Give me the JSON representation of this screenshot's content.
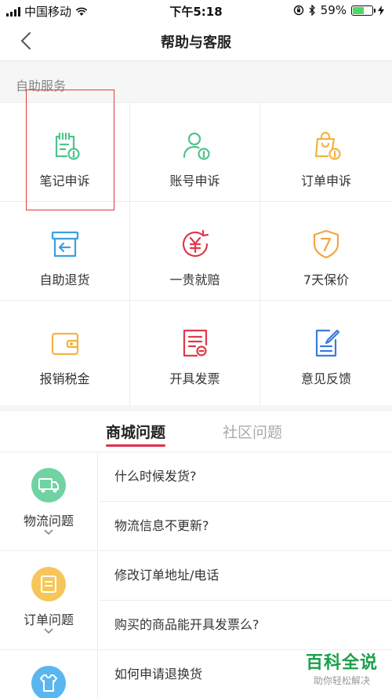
{
  "status_bar": {
    "carrier": "中国移动",
    "time": "下午5:18",
    "battery": "59%"
  },
  "nav": {
    "title": "帮助与客服"
  },
  "section": {
    "title": "自助服务"
  },
  "services": [
    {
      "label": "笔记申诉",
      "icon": "note-appeal-icon",
      "color": "#4fc38a"
    },
    {
      "label": "账号申诉",
      "icon": "account-appeal-icon",
      "color": "#4fc38a"
    },
    {
      "label": "订单申诉",
      "icon": "order-appeal-icon",
      "color": "#f2b43e"
    },
    {
      "label": "自助退货",
      "icon": "return-box-icon",
      "color": "#3a9fe0"
    },
    {
      "label": "一贵就赔",
      "icon": "compensation-icon",
      "color": "#e0394b"
    },
    {
      "label": "7天保价",
      "icon": "price-protect-icon",
      "color": "#f2a53e"
    },
    {
      "label": "报销税金",
      "icon": "wallet-icon",
      "color": "#f2b43e"
    },
    {
      "label": "开具发票",
      "icon": "invoice-icon",
      "color": "#e0394b"
    },
    {
      "label": "意见反馈",
      "icon": "feedback-icon",
      "color": "#3a7be0"
    }
  ],
  "tabs": {
    "mall": "商城问题",
    "community": "社区问题"
  },
  "faq": {
    "logistics": {
      "name": "物流问题",
      "color": "#6fd3a3"
    },
    "order": {
      "name": "订单问题",
      "color": "#f6c65a"
    },
    "after": {
      "color": "#5bb6f0"
    },
    "questions": [
      "什么时候发货?",
      "物流信息不更新?",
      "修改订单地址/电话",
      "购买的商品能开具发票么?",
      "如何申请退换货"
    ]
  },
  "watermark": {
    "title": "百科全说",
    "subtitle": "助你轻松解决"
  }
}
